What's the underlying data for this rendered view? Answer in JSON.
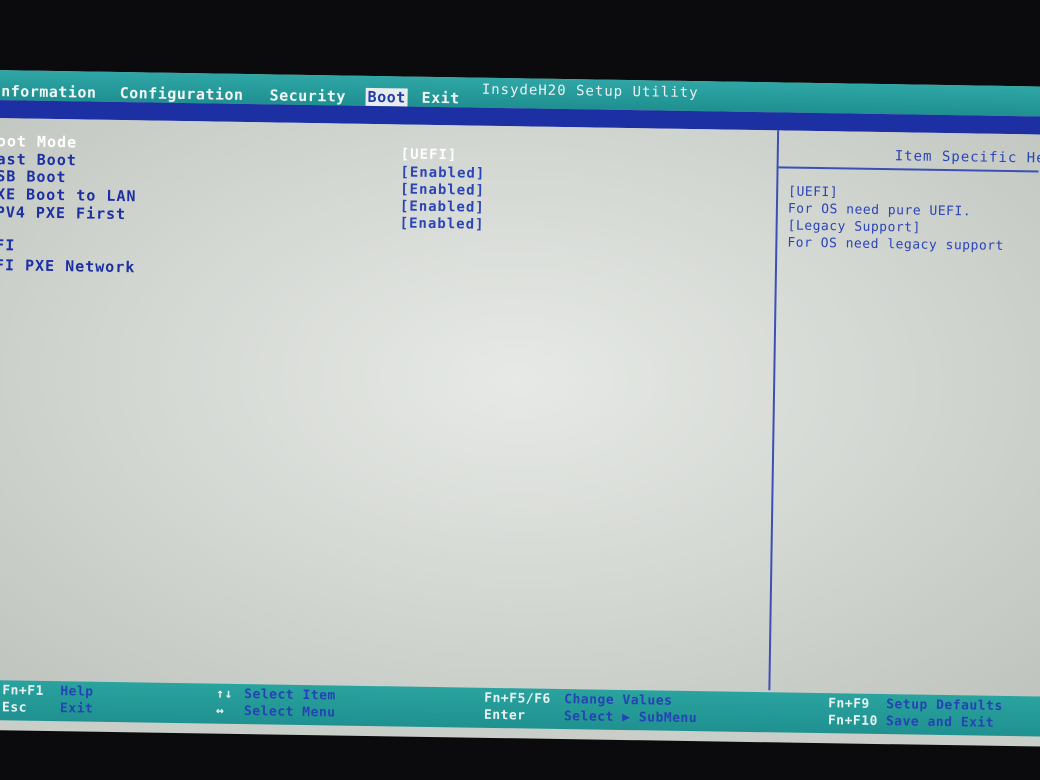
{
  "app_title": "InsydeH20 Setup Utility",
  "menu": {
    "tabs": [
      {
        "label": "Information"
      },
      {
        "label": "Configuration"
      },
      {
        "label": "Security"
      },
      {
        "label": "Boot"
      },
      {
        "label": "Exit"
      }
    ],
    "active_tab": "Boot"
  },
  "settings": [
    {
      "label": "oot Mode",
      "value": "[UEFI]",
      "selected": true
    },
    {
      "label": "ast Boot",
      "value": "[Enabled]"
    },
    {
      "label": "SB Boot",
      "value": "[Enabled]"
    },
    {
      "label": "XE Boot to LAN",
      "value": "[Enabled]"
    },
    {
      "label": "PV4 PXE First",
      "value": "[Enabled]"
    }
  ],
  "uefi_section": {
    "header": "FI",
    "item": "FI PXE Network"
  },
  "help_panel": {
    "title": "Item Specific He",
    "lines": [
      "[UEFI]",
      "For OS need pure UEFI.",
      "[Legacy Support]",
      "For OS need legacy support"
    ]
  },
  "footer": {
    "items": [
      {
        "key": "Fn+F1",
        "desc": "Help"
      },
      {
        "key": "Esc",
        "desc": "Exit"
      },
      {
        "key": "↑↓",
        "desc": "Select Item"
      },
      {
        "key": "↔",
        "desc": "Select Menu"
      },
      {
        "key": "Fn+F5/F6",
        "desc": "Change Values"
      },
      {
        "key": "Enter",
        "desc": "Select ▶ SubMenu"
      },
      {
        "key": "Fn+F9",
        "desc": "Setup Defaults"
      },
      {
        "key": "Fn+F10",
        "desc": "Save and Exit"
      }
    ]
  },
  "colors": {
    "teal_bar": "#1f8f90",
    "blue_accent": "#1c2fa3",
    "panel_gray": "#d2d6d1"
  }
}
